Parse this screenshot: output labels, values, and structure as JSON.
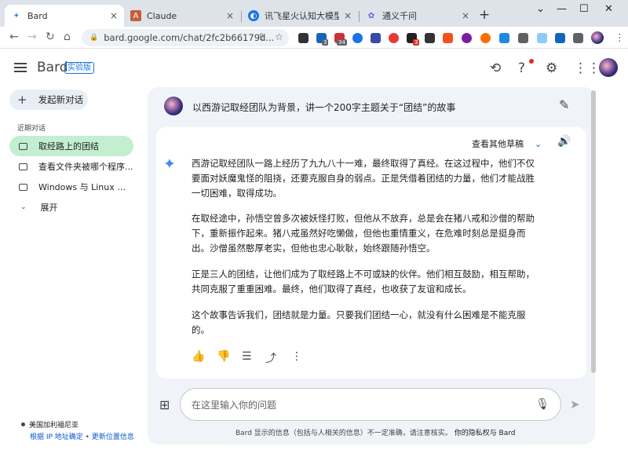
{
  "browser": {
    "tabs": [
      {
        "title": "Bard",
        "favicon": "bard-sparkle-icon",
        "active": true
      },
      {
        "title": "Claude",
        "favicon": "claude-icon",
        "active": false
      },
      {
        "title": "讯飞星火认知大模型-AI大",
        "favicon": "xunfei-icon",
        "active": false
      },
      {
        "title": "通义千问",
        "favicon": "tongyi-icon",
        "active": false
      }
    ],
    "tab_close_glyph": "×",
    "new_tab_glyph": "+",
    "window_controls": [
      "⌄",
      "—",
      "☐",
      "✕"
    ],
    "url": "bard.google.com/chat/2fc2b66179d...",
    "ext_badges": [
      "3",
      "34",
      "3"
    ],
    "accent": "#1a73e8"
  },
  "app": {
    "brand": "Bard",
    "badge": "实验版",
    "header_icons": [
      "history-icon",
      "help-icon",
      "settings-icon",
      "apps-grid-icon"
    ]
  },
  "sidebar": {
    "new_chat": "发起新对话",
    "recent_header": "近期对话",
    "chats": [
      {
        "label": "取经路上的团结",
        "selected": true
      },
      {
        "label": "查看文件夹被哪个程序...",
        "selected": false
      },
      {
        "label": "Windows 与 Linux 的 ...",
        "selected": false
      }
    ],
    "expand": "展开",
    "location": "美国加利福尼亚",
    "location_link": "根据 IP 地址确定 • 更新位置信息"
  },
  "conversation": {
    "question": "以西游记取经团队为背景，讲一个200字主题关于“团结”的故事",
    "view_drafts": "查看其他草稿",
    "paragraphs": [
      "西游记取经团队一路上经历了九九八十一难，最终取得了真经。在这过程中，他们不仅要面对妖魔鬼怪的阻挠，还要克服自身的弱点。正是凭借着团结的力量，他们才能战胜一切困难，取得成功。",
      "在取经途中，孙悟空曾多次被妖怪打败，但他从不放弃，总是会在猪八戒和沙僧的帮助下，重新振作起来。猪八戒虽然好吃懒做，但他也重情重义，在危难时刻总是挺身而出。沙僧虽然憨厚老实，但他也忠心耿耿，始终跟随孙悟空。",
      "正是三人的团结，让他们成为了取经路上不可或缺的伙伴。他们相互鼓励，相互帮助，共同克服了重重困难。最终，他们取得了真经，也收获了友谊和成长。",
      "这个故事告诉我们，团结就是力量。只要我们团结一心，就没有什么困难是不能克服的。"
    ]
  },
  "composer": {
    "placeholder": "在这里输入你的问题",
    "footer_text": "Bard 显示的信息（包括与人相关的信息）不一定准确，请注意核实。",
    "footer_link": "你的隐私权与 Bard"
  }
}
